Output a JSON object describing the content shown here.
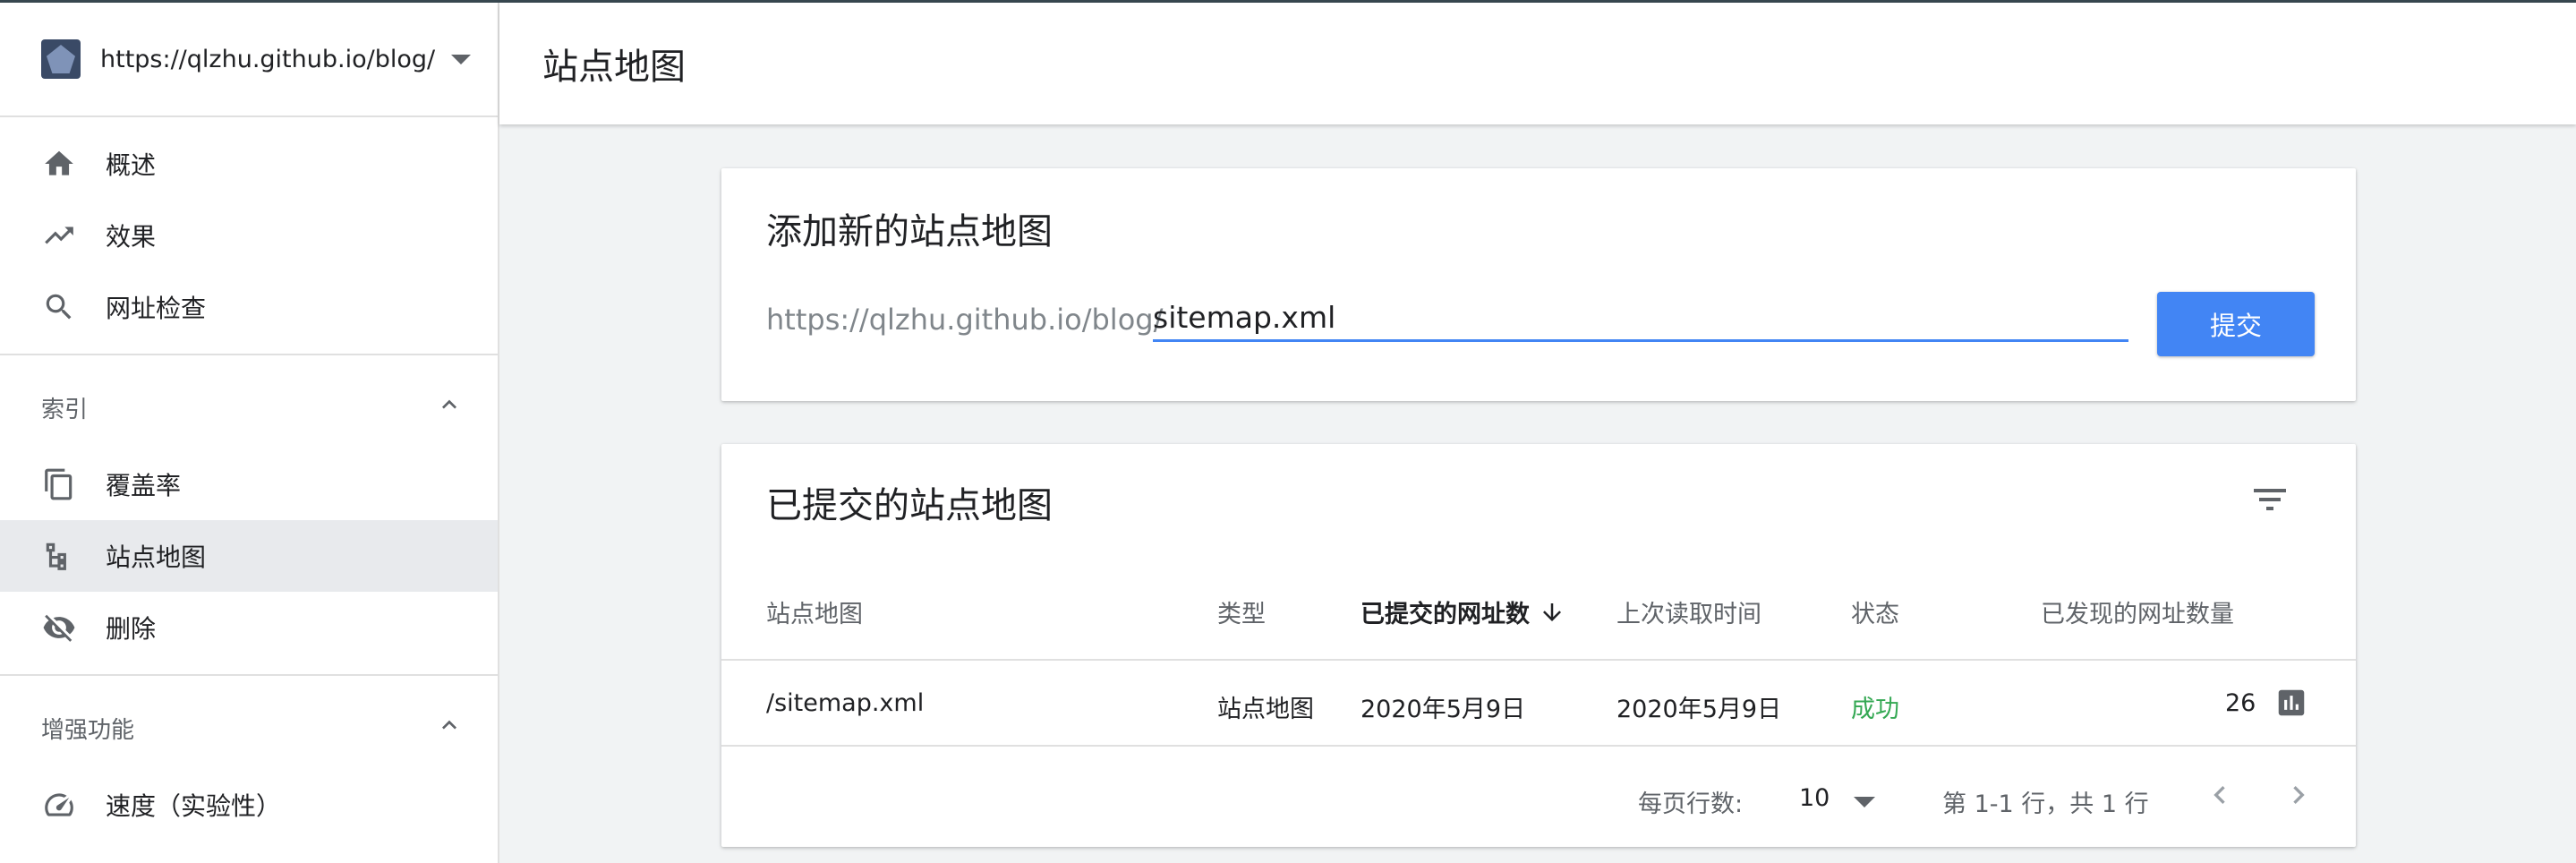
{
  "property": {
    "url": "https://qlzhu.github.io/blog/"
  },
  "nav": {
    "top_items": [
      {
        "label": "概述",
        "icon": "home-icon"
      },
      {
        "label": "效果",
        "icon": "trending-up-icon"
      },
      {
        "label": "网址检查",
        "icon": "search-icon"
      }
    ],
    "index_section": {
      "title": "索引",
      "items": [
        {
          "label": "覆盖率",
          "icon": "copy-pages-icon"
        },
        {
          "label": "站点地图",
          "icon": "sitemap-tree-icon",
          "active": true
        },
        {
          "label": "删除",
          "icon": "visibility-off-icon"
        }
      ]
    },
    "enhance_section": {
      "title": "增强功能",
      "items": [
        {
          "label": "速度（实验性）",
          "icon": "speedometer-icon"
        }
      ]
    }
  },
  "header": {
    "title": "站点地图"
  },
  "add_card": {
    "title": "添加新的站点地图",
    "prefix": "https://qlzhu.github.io/blog/",
    "input_value": "sitemap.xml",
    "submit_label": "提交"
  },
  "list_card": {
    "title": "已提交的站点地图",
    "columns": {
      "sitemap": "站点地图",
      "type": "类型",
      "submitted": "已提交的网址数",
      "last_read": "上次读取时间",
      "status": "状态",
      "discovered": "已发现的网址数量"
    },
    "rows": [
      {
        "sitemap": "/sitemap.xml",
        "type": "站点地图",
        "submitted": "2020年5月9日",
        "last_read": "2020年5月9日",
        "status": "成功",
        "discovered": "26"
      }
    ],
    "pagination": {
      "rows_per_page_label": "每页行数:",
      "rows_per_page": "10",
      "range_text": "第 1-1 行，共 1 行"
    }
  },
  "colors": {
    "accent": "#4285f4",
    "success": "#34a853"
  }
}
